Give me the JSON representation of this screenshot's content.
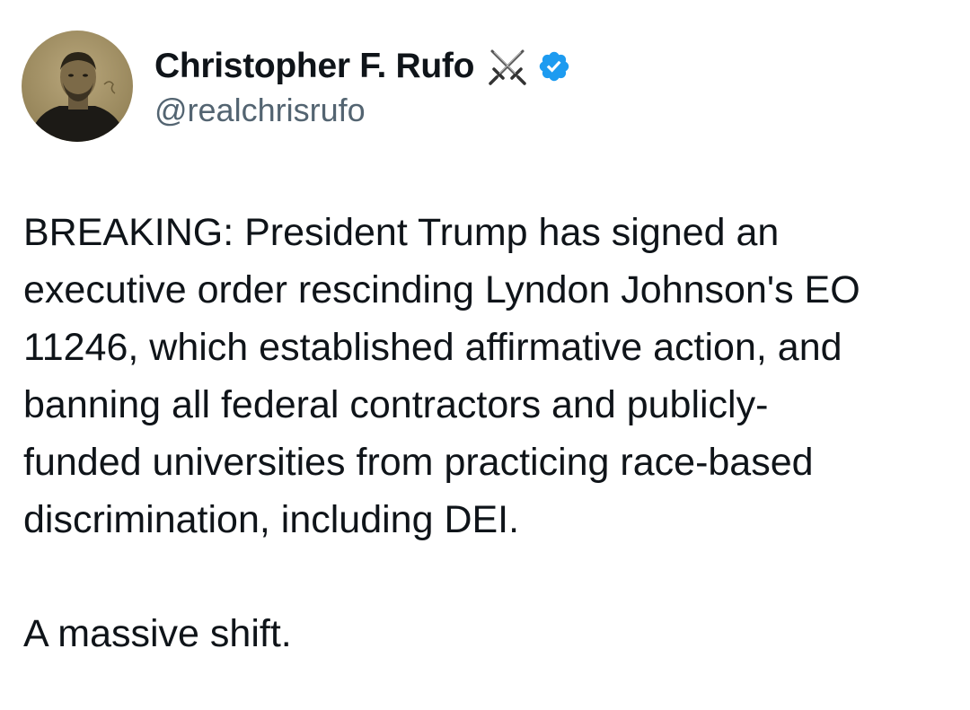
{
  "author": {
    "display_name": "Christopher F. Rufo",
    "handle": "@realchrisrufo",
    "name_emoji_icon": "crossed-swords-icon",
    "verified_icon": "verified-badge-icon",
    "verified_color": "#1d9bf0",
    "avatar_icon": "profile-photo"
  },
  "tweet": {
    "lines": [
      "BREAKING: President Trump has signed an",
      "executive order rescinding Lyndon Johnson's EO",
      "11246, which established affirmative action, and",
      "banning all federal contractors and publicly-",
      "funded universities from practicing race-based",
      "discrimination, including DEI."
    ],
    "closing": "A massive shift."
  },
  "colors": {
    "text": "#0f1419",
    "secondary_text": "#536471",
    "background": "#ffffff"
  }
}
